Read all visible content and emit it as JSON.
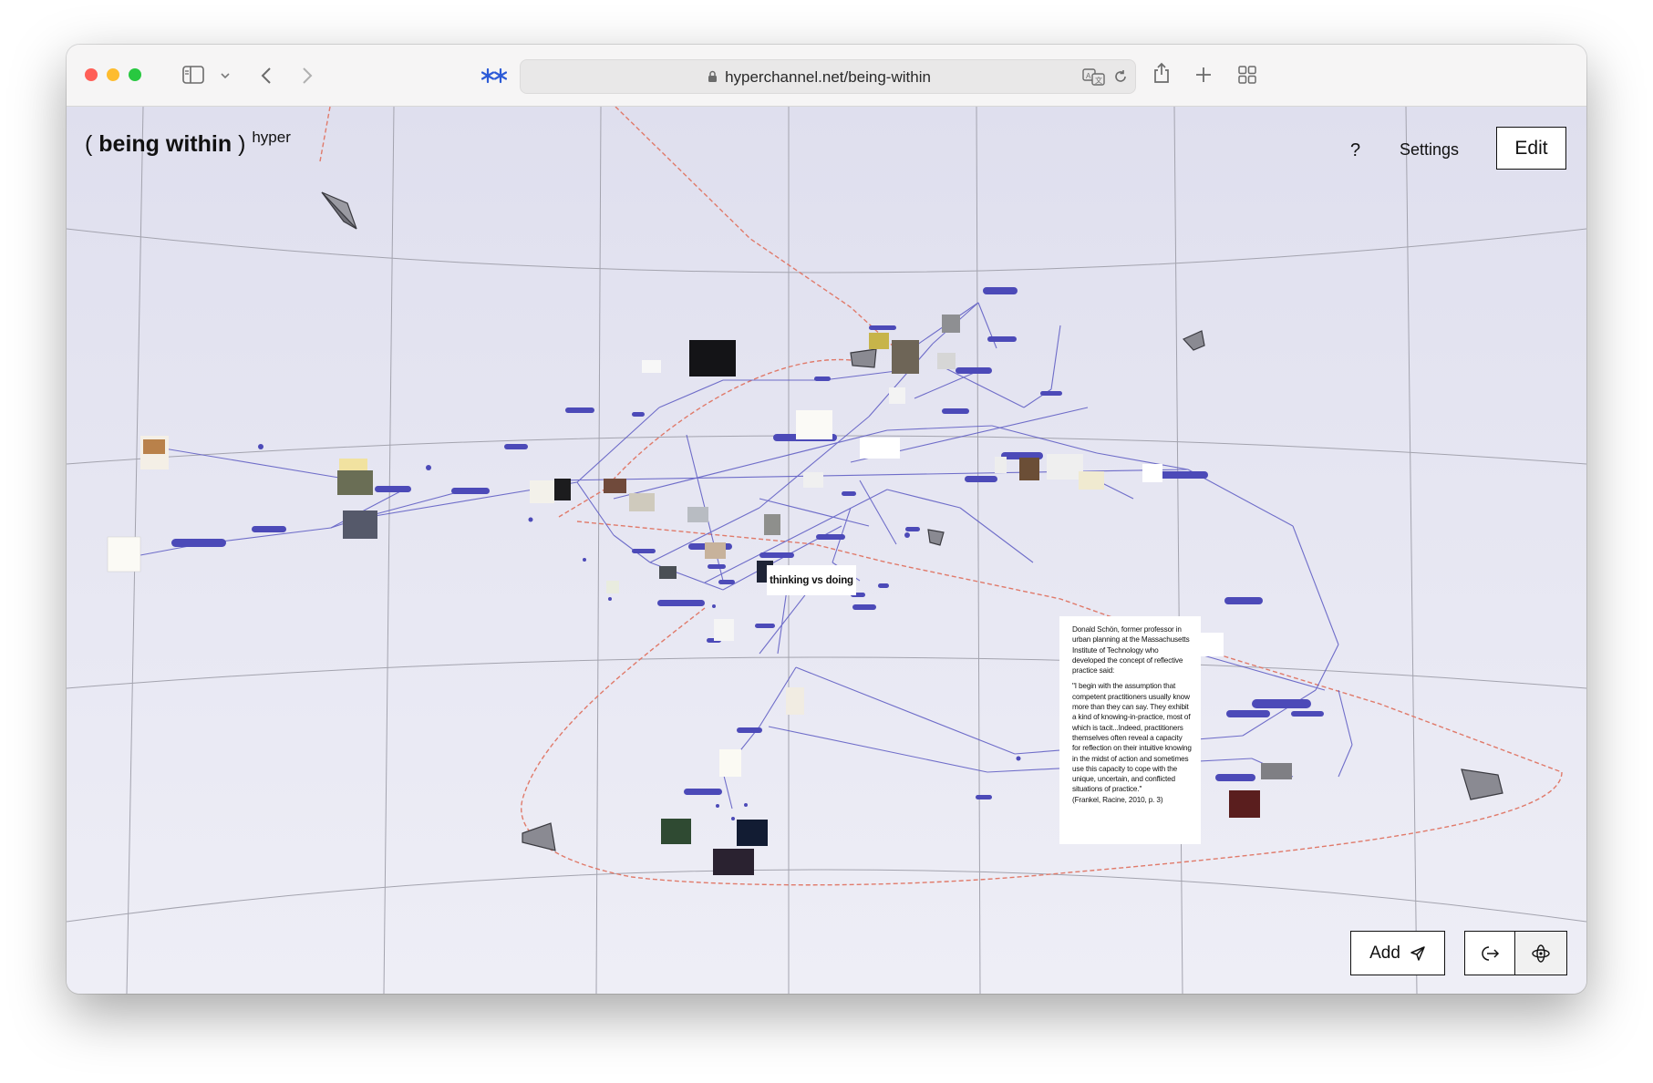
{
  "browser": {
    "url": "hyperchannel.net/being-within",
    "toolbar_icons": [
      "sidebar-icon",
      "chevron-down-icon",
      "back-icon",
      "forward-icon",
      "tab-group-icon",
      "lock-icon",
      "translate-icon",
      "reload-icon",
      "share-icon",
      "new-tab-icon",
      "tab-overview-icon"
    ]
  },
  "app": {
    "title_open": "(",
    "title_main": "being within",
    "title_close": ")",
    "title_sup": "hyper",
    "help_label": "?",
    "settings_label": "Settings",
    "edit_label": "Edit",
    "add_label": "Add",
    "add_icon": "paper-plane-icon",
    "exit_icon": "exit-view-icon",
    "orbit_icon": "orbit-icon"
  },
  "cards": {
    "thinking_vs_doing": "thinking vs doing",
    "quote_intro": "Donald Schön, former professor in urban planning at the Massachusetts Institute of Technology who developed the concept of reflective practice said:",
    "quote_body": "\"I begin with the assumption that competent practitioners usually know more than they can say. They exhibit a kind of knowing-in-practice, most of which is tacit...Indeed, practitioners themselves often reveal a capacity for reflection on their intuitive knowing in the midst of action and sometimes use this capacity to cope with the unique, uncertain, and conflicted situations of practice.\"",
    "quote_citation": "(Frankel, Racine, 2010, p. 3)"
  },
  "colors": {
    "edge": "#5a58c2",
    "path": "#e07a6a",
    "grid": "#9e9eaa",
    "close": "#ff5f57",
    "minimize": "#febc2e",
    "zoom": "#28c840",
    "accent": "#2d5bd7"
  }
}
